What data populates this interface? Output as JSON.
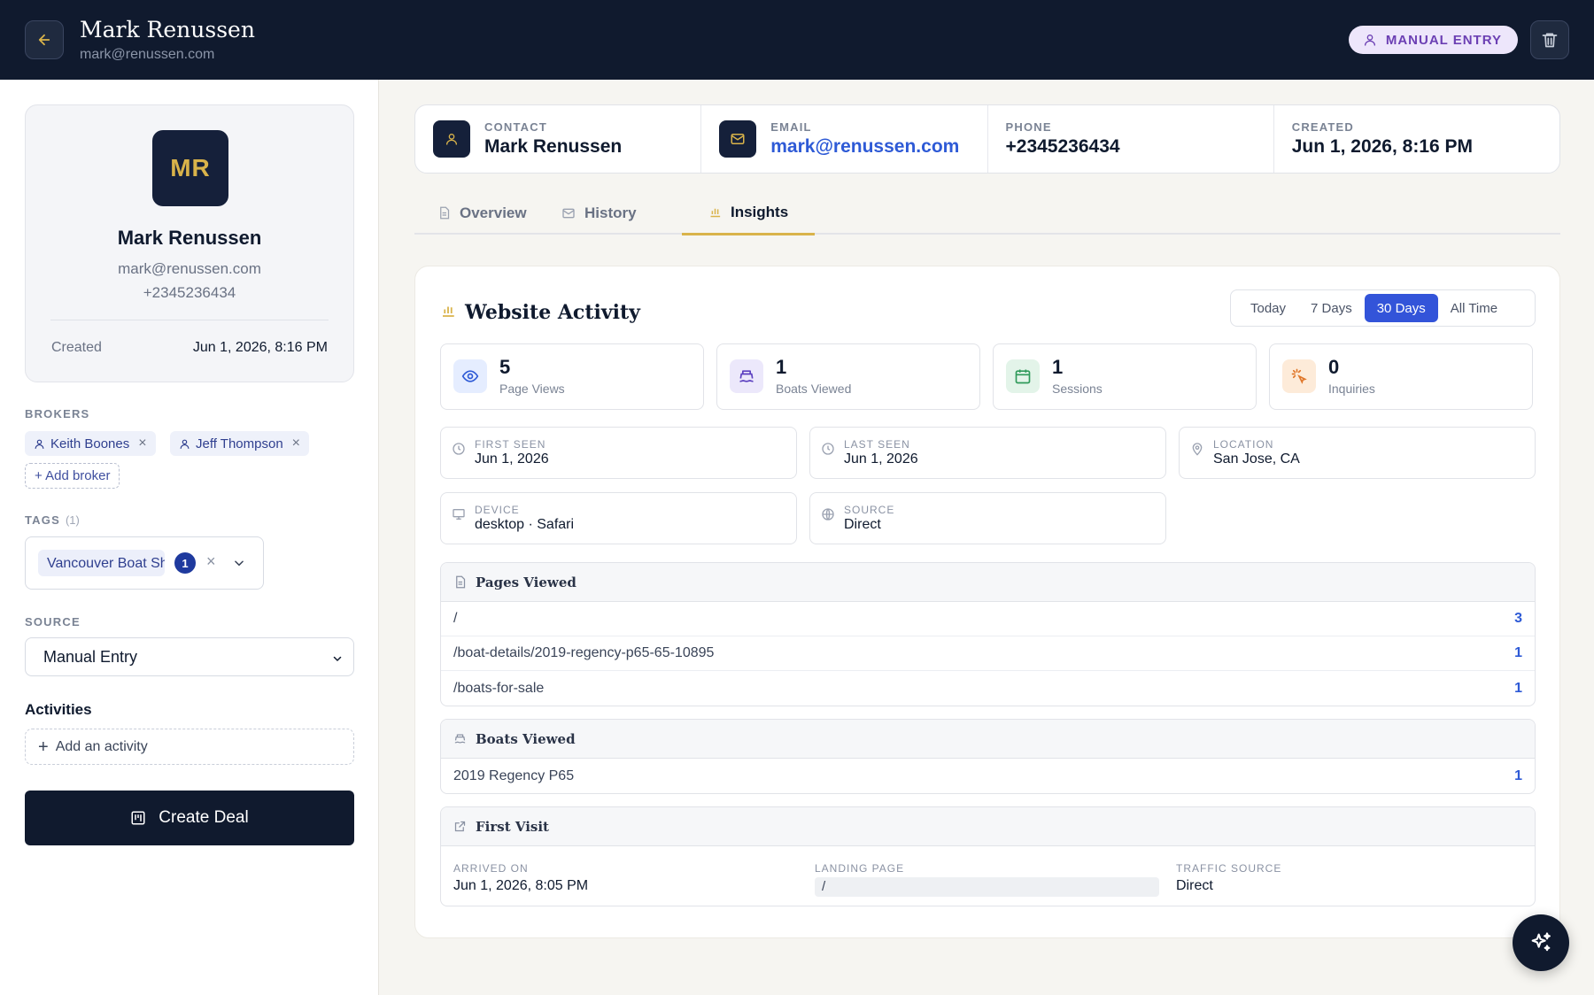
{
  "header": {
    "name": "Mark Renussen",
    "email": "mark@renussen.com",
    "badge": "MANUAL ENTRY"
  },
  "profile": {
    "initials": "MR",
    "name": "Mark Renussen",
    "email": "mark@renussen.com",
    "phone": "+2345236434",
    "created_label": "Created",
    "created_value": "Jun 1, 2026, 8:16 PM"
  },
  "brokers": {
    "label": "BROKERS",
    "items": [
      "Keith Boones",
      "Jeff Thompson"
    ],
    "add_label": "+ Add broker"
  },
  "tags": {
    "label": "TAGS",
    "count": "(1)",
    "chip": "Vancouver Boat Show",
    "badge": "1"
  },
  "source": {
    "label": "SOURCE",
    "value": "Manual Entry"
  },
  "activities": {
    "label": "Activities",
    "add_label": "Add an activity"
  },
  "create_deal_label": "Create Deal",
  "summary": [
    {
      "label": "CONTACT",
      "value": "Mark Renussen"
    },
    {
      "label": "EMAIL",
      "value": "mark@renussen.com"
    },
    {
      "label": "PHONE",
      "value": "+2345236434"
    },
    {
      "label": "CREATED",
      "value": "Jun 1, 2026, 8:16 PM"
    }
  ],
  "tabs": [
    {
      "label": "Overview"
    },
    {
      "label": "History"
    },
    {
      "label": "Insights",
      "active": true
    }
  ],
  "activity": {
    "title": "Website Activity",
    "ranges": [
      "Today",
      "7 Days",
      "30 Days",
      "All Time"
    ],
    "selected_range": "30 Days",
    "stats": [
      {
        "value": "5",
        "label": "Page Views",
        "icon": "eye-icon"
      },
      {
        "value": "1",
        "label": "Boats Viewed",
        "icon": "boat-icon"
      },
      {
        "value": "1",
        "label": "Sessions",
        "icon": "calendar-icon"
      },
      {
        "value": "0",
        "label": "Inquiries",
        "icon": "cursor-click-icon"
      }
    ],
    "info": [
      {
        "label": "FIRST SEEN",
        "value": "Jun 1, 2026"
      },
      {
        "label": "LAST SEEN",
        "value": "Jun 1, 2026"
      },
      {
        "label": "LOCATION",
        "value": "San Jose, CA"
      },
      {
        "label": "DEVICE",
        "value": "desktop · Safari"
      },
      {
        "label": "SOURCE",
        "value": "Direct"
      }
    ],
    "pages_viewed": {
      "title": "Pages Viewed",
      "rows": [
        {
          "path": "/",
          "count": "3"
        },
        {
          "path": "/boat-details/2019-regency-p65-65-10895",
          "count": "1"
        },
        {
          "path": "/boats-for-sale",
          "count": "1"
        }
      ]
    },
    "boats_viewed": {
      "title": "Boats Viewed",
      "rows": [
        {
          "name": "2019 Regency P65",
          "count": "1"
        }
      ]
    },
    "first_visit": {
      "title": "First Visit",
      "arrived_label": "ARRIVED ON",
      "arrived_value": "Jun 1, 2026, 8:05 PM",
      "landing_label": "LANDING PAGE",
      "landing_value": "/",
      "traffic_label": "TRAFFIC SOURCE",
      "traffic_value": "Direct"
    }
  },
  "colors": {
    "navy": "#101a2e",
    "gold": "#d9b34a",
    "accent_blue": "#3354d9",
    "link_blue": "#2e5ad6"
  }
}
